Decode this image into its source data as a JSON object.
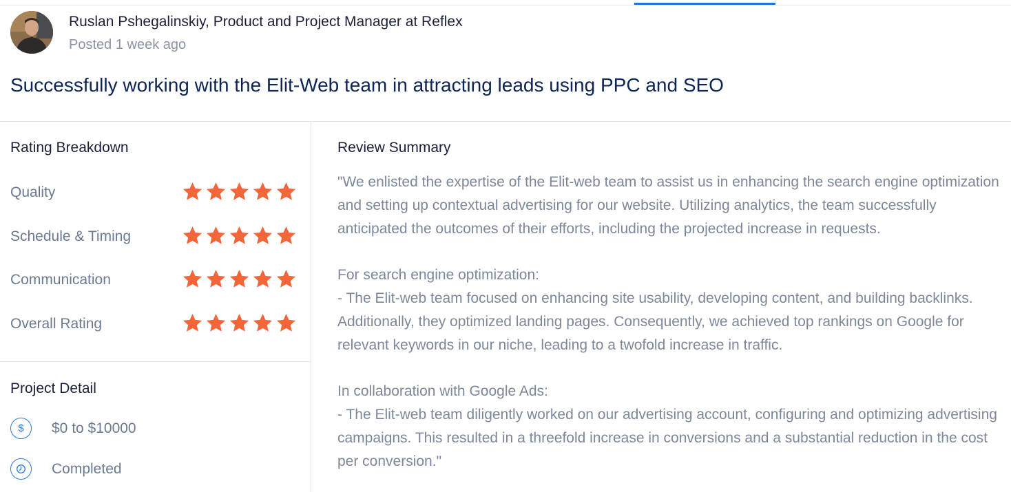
{
  "reviewer": {
    "name_line": "Ruslan Pshegalinskiy, Product and Project Manager at Reflex",
    "posted": "Posted 1 week ago"
  },
  "review": {
    "title": "Successfully working with the Elit-Web team in attracting leads using PPC and SEO"
  },
  "rating_breakdown": {
    "heading": "Rating Breakdown",
    "star_color": "#f2663a",
    "items": [
      {
        "label": "Quality",
        "stars": 5
      },
      {
        "label": "Schedule & Timing",
        "stars": 5
      },
      {
        "label": "Communication",
        "stars": 5
      },
      {
        "label": "Overall Rating",
        "stars": 5
      }
    ]
  },
  "project_detail": {
    "heading": "Project Detail",
    "budget": {
      "icon": "dollar-icon",
      "text": "$0 to $10000"
    },
    "status": {
      "icon": "clock-icon",
      "text": "Completed"
    }
  },
  "review_summary": {
    "heading": "Review Summary",
    "paragraphs": [
      "\"We enlisted the expertise of the Elit-web team to assist us in enhancing the search engine optimization and setting up contextual advertising for our website. Utilizing analytics, the team successfully anticipated the outcomes of their efforts, including the projected increase in requests.",
      "For search engine optimization:",
      "- The Elit-web team focused on enhancing site usability, developing content, and building backlinks. Additionally, they optimized landing pages. Consequently, we achieved top rankings on Google for relevant keywords in our niche, leading to a twofold increase in traffic.",
      "In collaboration with Google Ads:",
      "- The Elit-web team diligently worked on our advertising account, configuring and optimizing advertising campaigns. This resulted in a threefold increase in conversions and a substantial reduction in the cost per conversion.\""
    ]
  },
  "colors": {
    "accent": "#1e73d8",
    "title": "#0d2456",
    "muted_text": "#7c8799"
  }
}
